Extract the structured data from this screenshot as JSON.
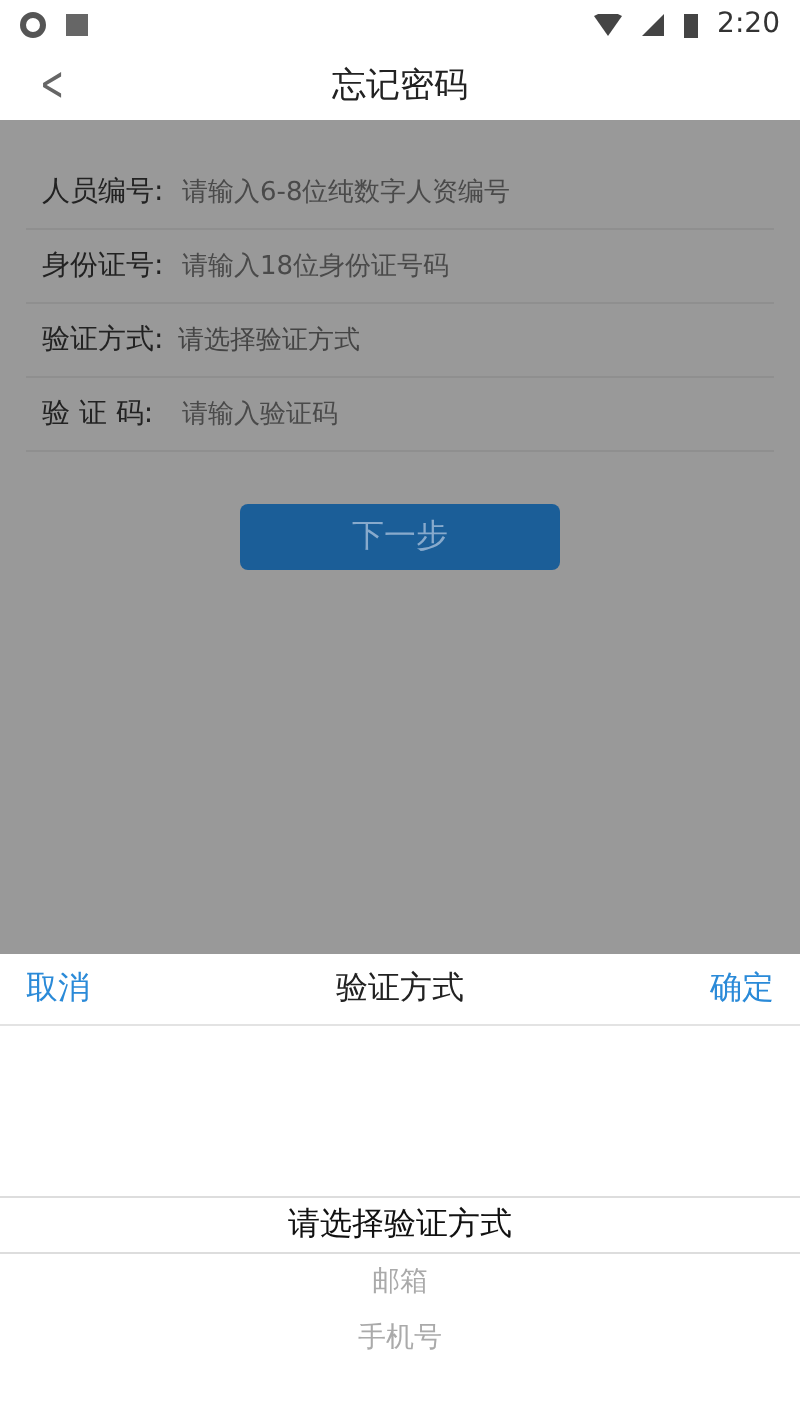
{
  "status_bar": {
    "time": "2:20"
  },
  "header": {
    "back": "<",
    "title": "忘记密码"
  },
  "form": {
    "fields": [
      {
        "label": "人员编号:",
        "placeholder": "请输入6-8位纯数字人资编号",
        "kind": "input"
      },
      {
        "label": "身份证号:",
        "placeholder": "请输入18位身份证号码",
        "kind": "input"
      },
      {
        "label": "验证方式:",
        "value": "请选择验证方式",
        "kind": "select"
      },
      {
        "label": "验 证 码:",
        "placeholder": "请输入验证码",
        "kind": "input"
      }
    ],
    "submit": "下一步"
  },
  "picker": {
    "cancel": "取消",
    "title": "验证方式",
    "confirm": "确定",
    "options": [
      {
        "label": "请选择验证方式",
        "selected": true
      },
      {
        "label": "邮箱",
        "selected": false
      },
      {
        "label": "手机号",
        "selected": false
      }
    ]
  }
}
